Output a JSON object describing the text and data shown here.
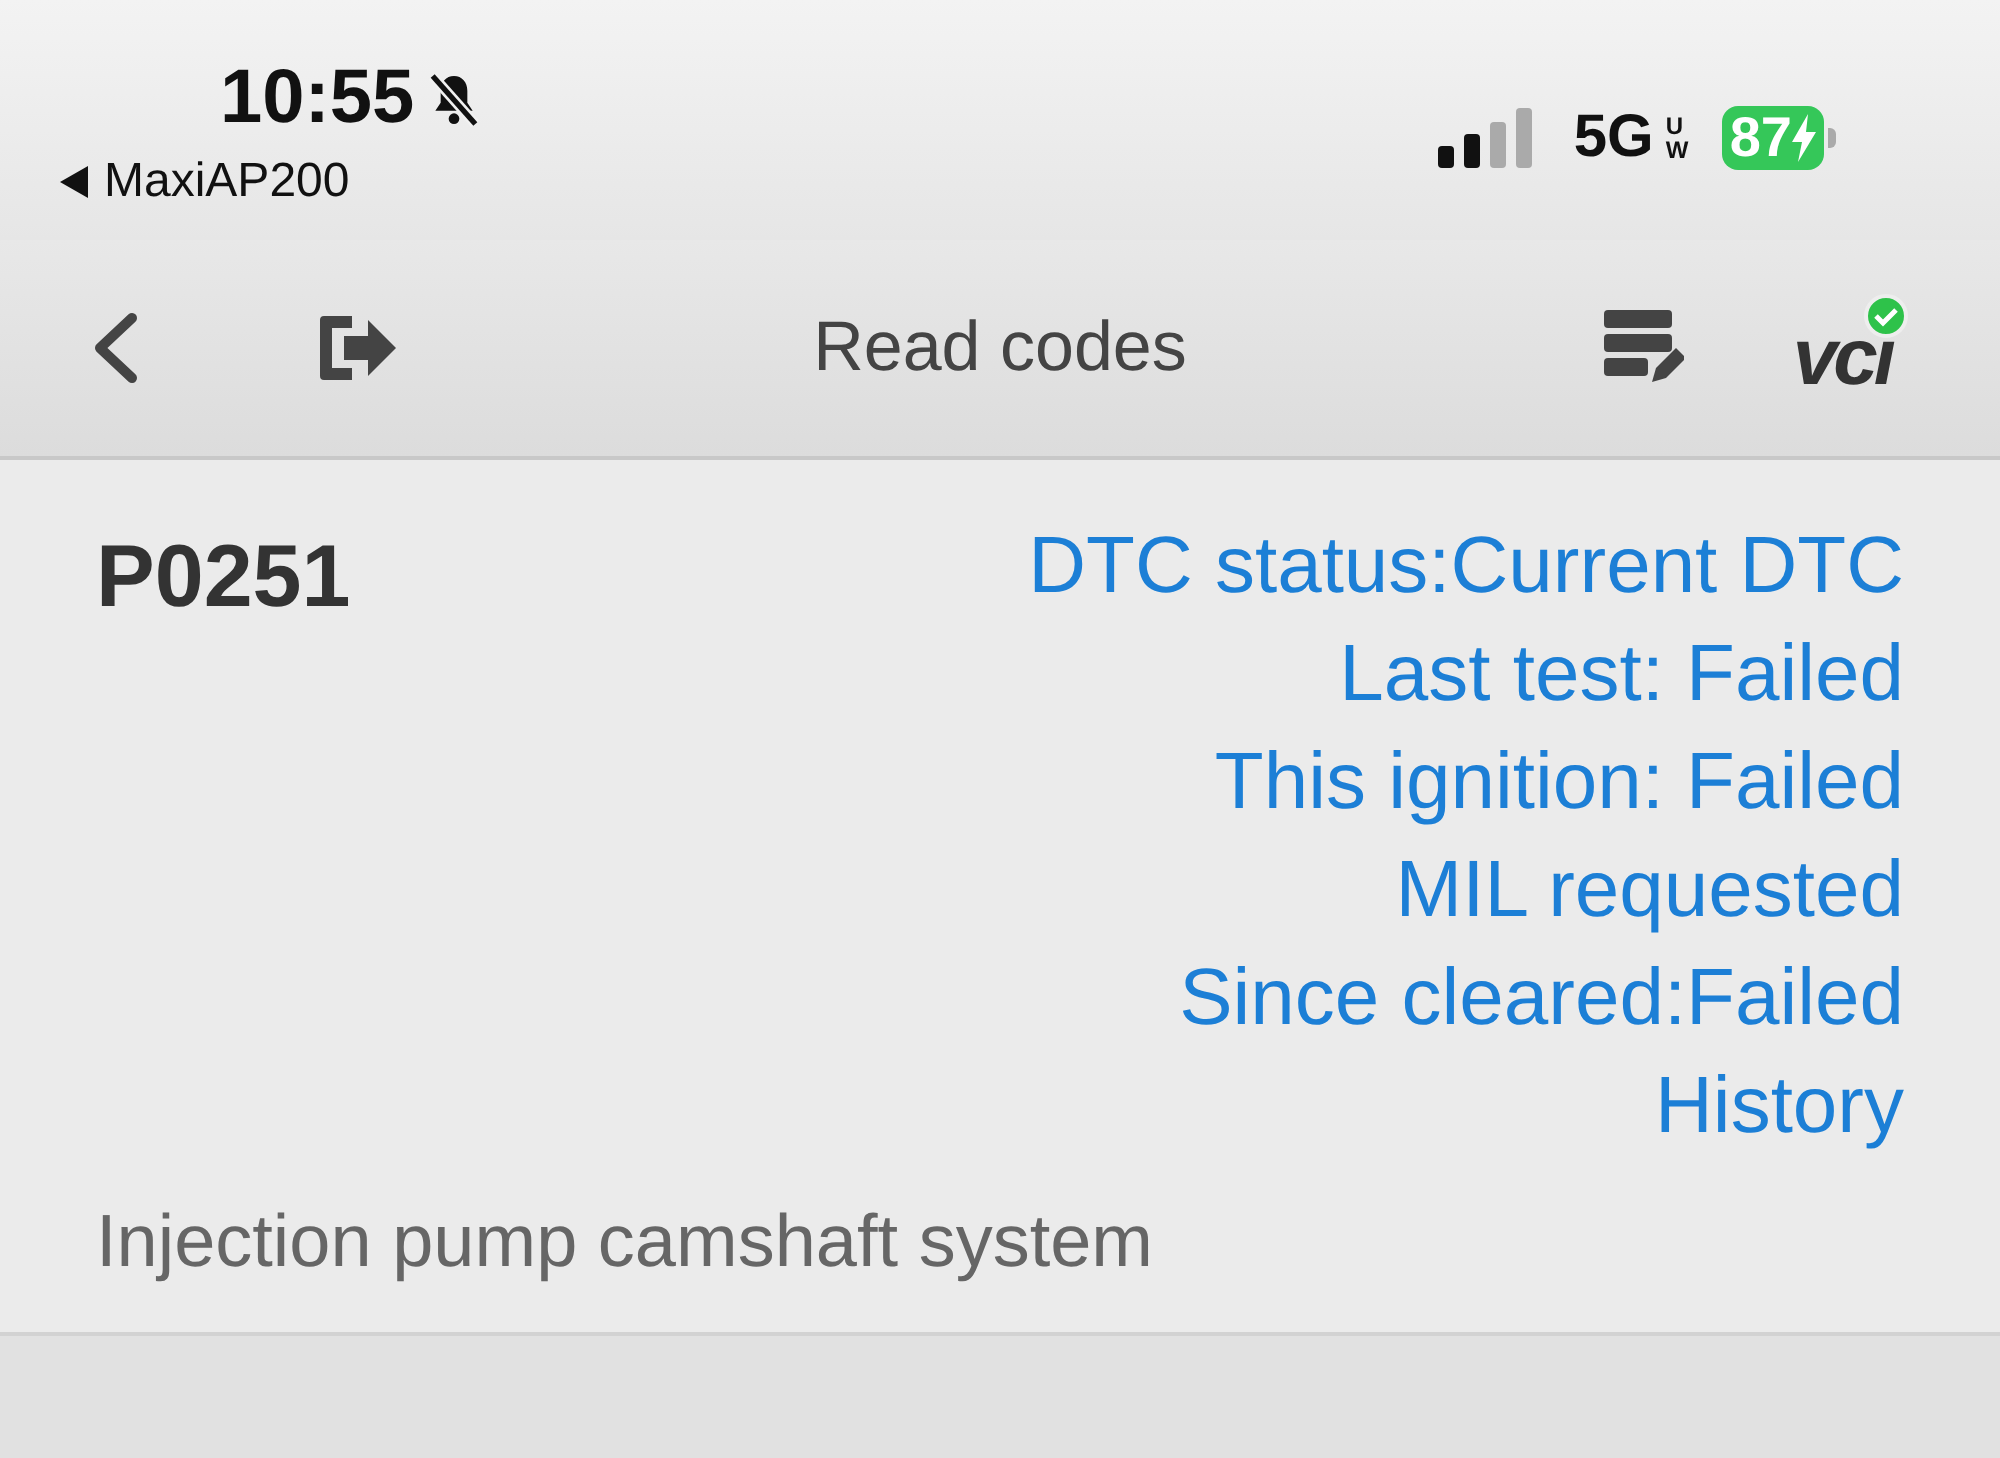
{
  "status_bar": {
    "time": "10:55",
    "silent": true,
    "back_app": "MaxiAP200",
    "network": "5G",
    "network_sub": "UW",
    "battery": "87",
    "charging": true
  },
  "nav_bar": {
    "title": "Read codes",
    "vci_label": "vci",
    "vci_connected": true
  },
  "dtc": {
    "code": "P0251",
    "statuses": [
      "DTC status:Current DTC",
      "Last test: Failed",
      "This ignition: Failed",
      "MIL requested",
      "Since cleared:Failed",
      "History"
    ],
    "description": "Injection pump camshaft system"
  }
}
